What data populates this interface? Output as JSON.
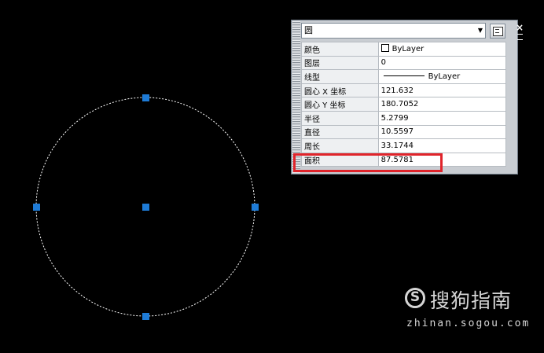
{
  "drawing": {
    "entity": "circle",
    "grip_color": "#1e7bd6",
    "circle_stroke": "#ffffff",
    "circle_line": "dashed"
  },
  "properties_palette": {
    "object_type": "圆",
    "dropdown_icon": "chevron-down-icon",
    "quick_select_icon": "quick-select-icon",
    "close_glyph": "×",
    "rows": [
      {
        "label": "颜色",
        "value": "ByLayer",
        "swatch": true
      },
      {
        "label": "图层",
        "value": "0"
      },
      {
        "label": "线型",
        "value": "ByLayer",
        "linetype_sample": true
      },
      {
        "label": "圆心 X 坐标",
        "value": "121.632"
      },
      {
        "label": "圆心 Y 坐标",
        "value": "180.7052"
      },
      {
        "label": "半径",
        "value": "5.2799"
      },
      {
        "label": "直径",
        "value": "10.5597"
      },
      {
        "label": "周长",
        "value": "33.1744"
      },
      {
        "label": "面积",
        "value": "87.5781"
      }
    ],
    "highlight_color": "#e0242b",
    "highlighted_row": "面积"
  },
  "watermark": {
    "logo_glyph": "S",
    "name": "搜狗指南",
    "url": "zhinan.sogou.com"
  }
}
